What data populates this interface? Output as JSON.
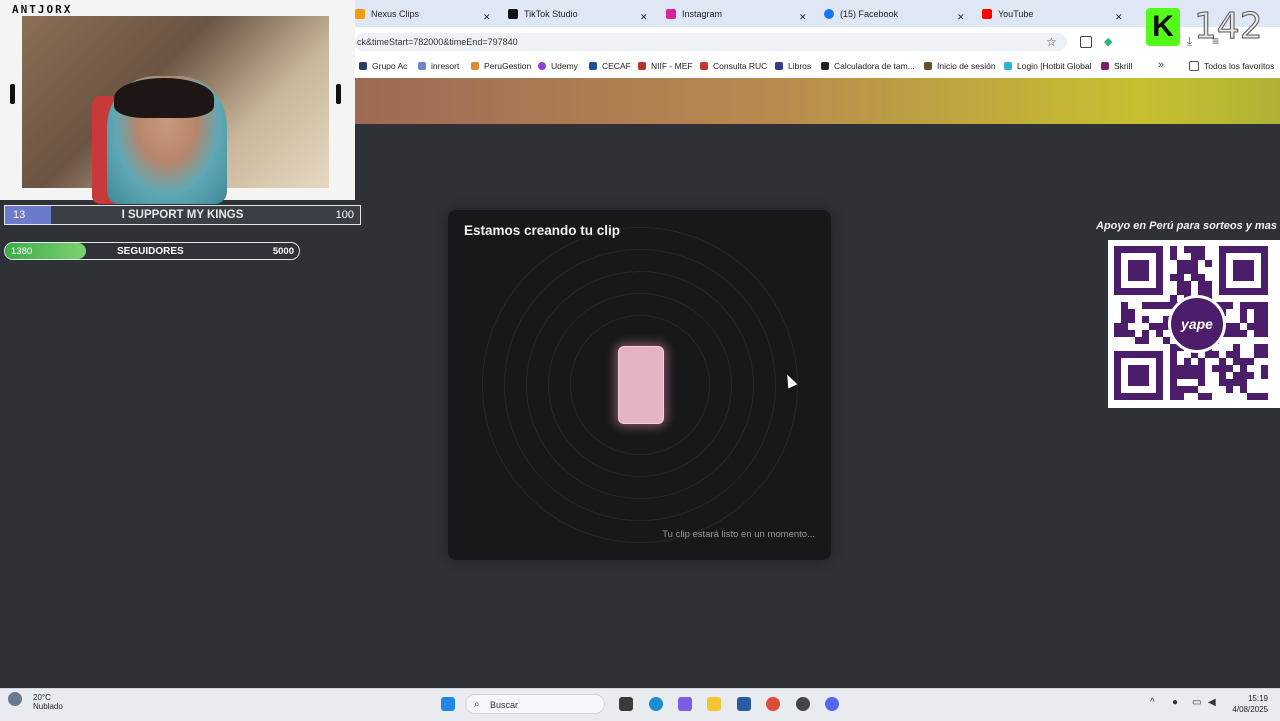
{
  "tabs": [
    {
      "title": "Nexus Clips",
      "color": "#f39c12"
    },
    {
      "title": "TikTok Studio",
      "color": "#111111"
    },
    {
      "title": "Instagram",
      "color": "#d6249f"
    },
    {
      "title": "(15) Facebook",
      "color": "#1877f2"
    },
    {
      "title": "YouTube",
      "color": "#ff0000"
    }
  ],
  "address": {
    "url": "ck&timeStart=782000&timeEnd=797840"
  },
  "bookmarks": [
    {
      "label": "Grupo Ac"
    },
    {
      "label": "inresort"
    },
    {
      "label": "PeruGestion"
    },
    {
      "label": "Udemy"
    },
    {
      "label": "CECAF"
    },
    {
      "label": "NIIF - MEF"
    },
    {
      "label": "Consulta RUC"
    },
    {
      "label": "Libros"
    },
    {
      "label": "Calculadora de tam..."
    },
    {
      "label": "Inicio de sesión"
    },
    {
      "label": "Login |Hotbit Global"
    },
    {
      "label": "Skrill"
    },
    {
      "label": "Todos los favoritos"
    }
  ],
  "modal": {
    "title": "Estamos creando tu clip",
    "footer": "Tu clip estará listo en un momento..."
  },
  "overlay": {
    "brand": "ANTJORX",
    "goal1": {
      "current": "13",
      "label": "I SUPPORT MY KINGS",
      "target": "100",
      "progress": 0.13
    },
    "goal2": {
      "current": "1380",
      "label": "SEGUIDORES",
      "target": "5000",
      "progress": 0.276
    },
    "support_text": "Apoyo en Perú para sorteos y mas",
    "qr_logo": "yape",
    "kick_count": "142"
  },
  "taskbar": {
    "temp": "20°C",
    "weather": "Nublado",
    "search": "Buscar",
    "time": "15:19",
    "date": "4/08/2025"
  }
}
